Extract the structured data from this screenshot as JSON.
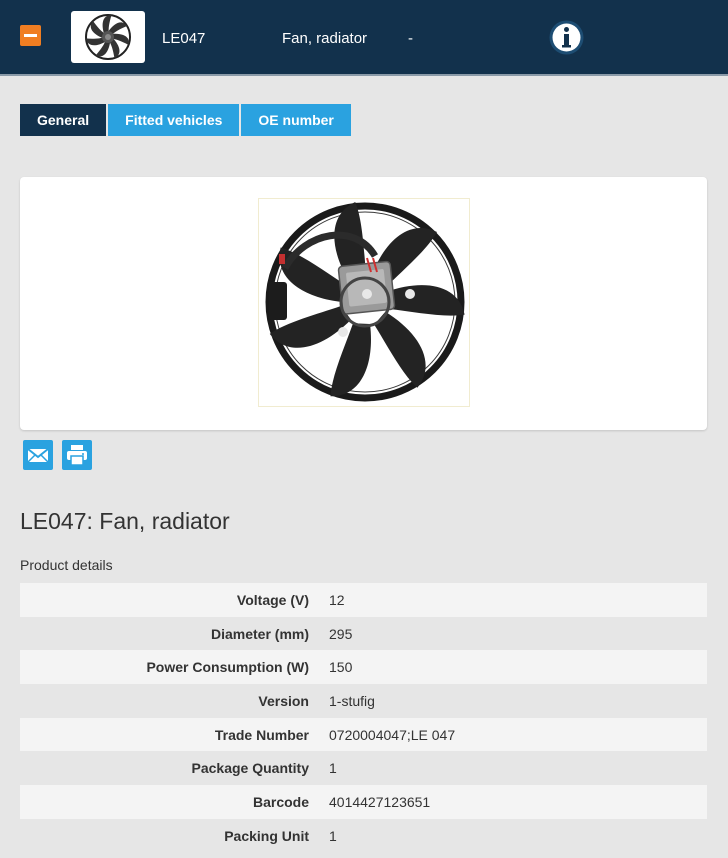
{
  "header": {
    "code": "LE047",
    "description": "Fan, radiator",
    "extra": "-"
  },
  "tabs": [
    {
      "label": "General"
    },
    {
      "label": "Fitted vehicles"
    },
    {
      "label": "OE number"
    }
  ],
  "product": {
    "title": "LE047: Fan, radiator",
    "details_label": "Product details",
    "details": [
      {
        "key": "Voltage (V)",
        "value": "12"
      },
      {
        "key": "Diameter (mm)",
        "value": "295"
      },
      {
        "key": "Power Consumption (W)",
        "value": "150"
      },
      {
        "key": "Version",
        "value": "1-stufig"
      },
      {
        "key": "Trade Number",
        "value": "0720004047;LE 047"
      },
      {
        "key": "Package Quantity",
        "value": "1"
      },
      {
        "key": "Barcode",
        "value": "4014427123651"
      },
      {
        "key": "Packing Unit",
        "value": "1"
      }
    ]
  },
  "icons": [
    "collapse-icon",
    "fan-icon",
    "info-icon",
    "mail-icon",
    "print-icon"
  ],
  "colors": {
    "header_bg": "#12314c",
    "accent": "#2aa2e0",
    "orange": "#f07e22"
  }
}
